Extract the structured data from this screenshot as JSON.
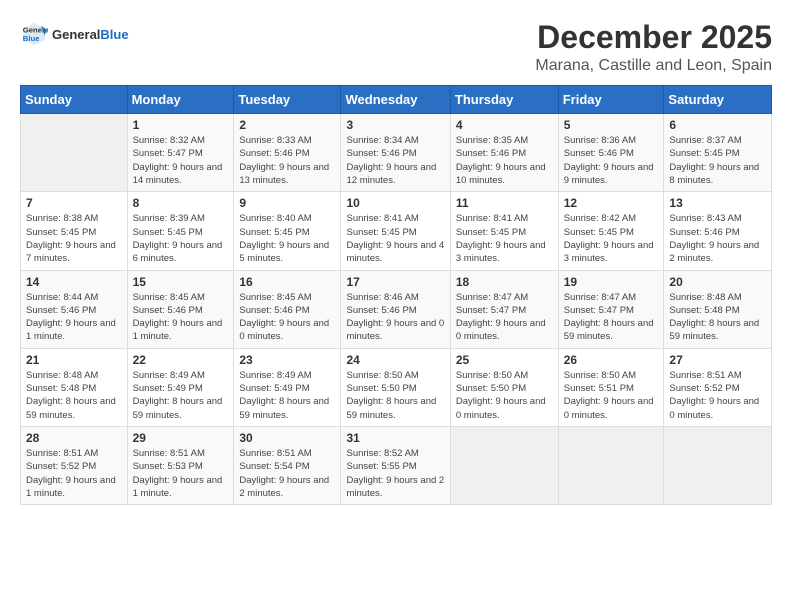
{
  "logo": {
    "general": "General",
    "blue": "Blue"
  },
  "header": {
    "month": "December 2025",
    "location": "Marana, Castille and Leon, Spain"
  },
  "weekdays": [
    "Sunday",
    "Monday",
    "Tuesday",
    "Wednesday",
    "Thursday",
    "Friday",
    "Saturday"
  ],
  "weeks": [
    [
      {
        "day": "",
        "sunrise": "",
        "sunset": "",
        "daylight": ""
      },
      {
        "day": "1",
        "sunrise": "Sunrise: 8:32 AM",
        "sunset": "Sunset: 5:47 PM",
        "daylight": "Daylight: 9 hours and 14 minutes."
      },
      {
        "day": "2",
        "sunrise": "Sunrise: 8:33 AM",
        "sunset": "Sunset: 5:46 PM",
        "daylight": "Daylight: 9 hours and 13 minutes."
      },
      {
        "day": "3",
        "sunrise": "Sunrise: 8:34 AM",
        "sunset": "Sunset: 5:46 PM",
        "daylight": "Daylight: 9 hours and 12 minutes."
      },
      {
        "day": "4",
        "sunrise": "Sunrise: 8:35 AM",
        "sunset": "Sunset: 5:46 PM",
        "daylight": "Daylight: 9 hours and 10 minutes."
      },
      {
        "day": "5",
        "sunrise": "Sunrise: 8:36 AM",
        "sunset": "Sunset: 5:46 PM",
        "daylight": "Daylight: 9 hours and 9 minutes."
      },
      {
        "day": "6",
        "sunrise": "Sunrise: 8:37 AM",
        "sunset": "Sunset: 5:45 PM",
        "daylight": "Daylight: 9 hours and 8 minutes."
      }
    ],
    [
      {
        "day": "7",
        "sunrise": "Sunrise: 8:38 AM",
        "sunset": "Sunset: 5:45 PM",
        "daylight": "Daylight: 9 hours and 7 minutes."
      },
      {
        "day": "8",
        "sunrise": "Sunrise: 8:39 AM",
        "sunset": "Sunset: 5:45 PM",
        "daylight": "Daylight: 9 hours and 6 minutes."
      },
      {
        "day": "9",
        "sunrise": "Sunrise: 8:40 AM",
        "sunset": "Sunset: 5:45 PM",
        "daylight": "Daylight: 9 hours and 5 minutes."
      },
      {
        "day": "10",
        "sunrise": "Sunrise: 8:41 AM",
        "sunset": "Sunset: 5:45 PM",
        "daylight": "Daylight: 9 hours and 4 minutes."
      },
      {
        "day": "11",
        "sunrise": "Sunrise: 8:41 AM",
        "sunset": "Sunset: 5:45 PM",
        "daylight": "Daylight: 9 hours and 3 minutes."
      },
      {
        "day": "12",
        "sunrise": "Sunrise: 8:42 AM",
        "sunset": "Sunset: 5:45 PM",
        "daylight": "Daylight: 9 hours and 3 minutes."
      },
      {
        "day": "13",
        "sunrise": "Sunrise: 8:43 AM",
        "sunset": "Sunset: 5:46 PM",
        "daylight": "Daylight: 9 hours and 2 minutes."
      }
    ],
    [
      {
        "day": "14",
        "sunrise": "Sunrise: 8:44 AM",
        "sunset": "Sunset: 5:46 PM",
        "daylight": "Daylight: 9 hours and 1 minute."
      },
      {
        "day": "15",
        "sunrise": "Sunrise: 8:45 AM",
        "sunset": "Sunset: 5:46 PM",
        "daylight": "Daylight: 9 hours and 1 minute."
      },
      {
        "day": "16",
        "sunrise": "Sunrise: 8:45 AM",
        "sunset": "Sunset: 5:46 PM",
        "daylight": "Daylight: 9 hours and 0 minutes."
      },
      {
        "day": "17",
        "sunrise": "Sunrise: 8:46 AM",
        "sunset": "Sunset: 5:46 PM",
        "daylight": "Daylight: 9 hours and 0 minutes."
      },
      {
        "day": "18",
        "sunrise": "Sunrise: 8:47 AM",
        "sunset": "Sunset: 5:47 PM",
        "daylight": "Daylight: 9 hours and 0 minutes."
      },
      {
        "day": "19",
        "sunrise": "Sunrise: 8:47 AM",
        "sunset": "Sunset: 5:47 PM",
        "daylight": "Daylight: 8 hours and 59 minutes."
      },
      {
        "day": "20",
        "sunrise": "Sunrise: 8:48 AM",
        "sunset": "Sunset: 5:48 PM",
        "daylight": "Daylight: 8 hours and 59 minutes."
      }
    ],
    [
      {
        "day": "21",
        "sunrise": "Sunrise: 8:48 AM",
        "sunset": "Sunset: 5:48 PM",
        "daylight": "Daylight: 8 hours and 59 minutes."
      },
      {
        "day": "22",
        "sunrise": "Sunrise: 8:49 AM",
        "sunset": "Sunset: 5:49 PM",
        "daylight": "Daylight: 8 hours and 59 minutes."
      },
      {
        "day": "23",
        "sunrise": "Sunrise: 8:49 AM",
        "sunset": "Sunset: 5:49 PM",
        "daylight": "Daylight: 8 hours and 59 minutes."
      },
      {
        "day": "24",
        "sunrise": "Sunrise: 8:50 AM",
        "sunset": "Sunset: 5:50 PM",
        "daylight": "Daylight: 8 hours and 59 minutes."
      },
      {
        "day": "25",
        "sunrise": "Sunrise: 8:50 AM",
        "sunset": "Sunset: 5:50 PM",
        "daylight": "Daylight: 9 hours and 0 minutes."
      },
      {
        "day": "26",
        "sunrise": "Sunrise: 8:50 AM",
        "sunset": "Sunset: 5:51 PM",
        "daylight": "Daylight: 9 hours and 0 minutes."
      },
      {
        "day": "27",
        "sunrise": "Sunrise: 8:51 AM",
        "sunset": "Sunset: 5:52 PM",
        "daylight": "Daylight: 9 hours and 0 minutes."
      }
    ],
    [
      {
        "day": "28",
        "sunrise": "Sunrise: 8:51 AM",
        "sunset": "Sunset: 5:52 PM",
        "daylight": "Daylight: 9 hours and 1 minute."
      },
      {
        "day": "29",
        "sunrise": "Sunrise: 8:51 AM",
        "sunset": "Sunset: 5:53 PM",
        "daylight": "Daylight: 9 hours and 1 minute."
      },
      {
        "day": "30",
        "sunrise": "Sunrise: 8:51 AM",
        "sunset": "Sunset: 5:54 PM",
        "daylight": "Daylight: 9 hours and 2 minutes."
      },
      {
        "day": "31",
        "sunrise": "Sunrise: 8:52 AM",
        "sunset": "Sunset: 5:55 PM",
        "daylight": "Daylight: 9 hours and 2 minutes."
      },
      {
        "day": "",
        "sunrise": "",
        "sunset": "",
        "daylight": ""
      },
      {
        "day": "",
        "sunrise": "",
        "sunset": "",
        "daylight": ""
      },
      {
        "day": "",
        "sunrise": "",
        "sunset": "",
        "daylight": ""
      }
    ]
  ]
}
